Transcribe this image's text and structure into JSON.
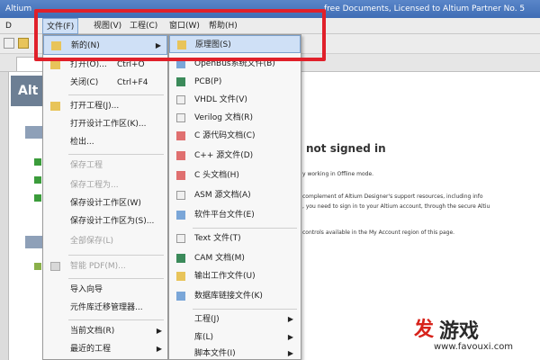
{
  "titlebar": {
    "left_text": "Altium",
    "right_text": "free Documents, Licensed to Altium Partner No. 5"
  },
  "menubar": {
    "items": [
      "文件(F)",
      "视图(V)",
      "工程(C)",
      "窗口(W)",
      "帮助(H)"
    ],
    "leading": "D"
  },
  "file_menu": {
    "items": [
      {
        "label": "新的(N)",
        "arrow": "▶"
      },
      {
        "label": "打开(O)...",
        "shortcut": "Ctrl+O"
      },
      {
        "label": "关闭(C)",
        "shortcut": "Ctrl+F4"
      },
      {
        "label": "打开工程(J)..."
      },
      {
        "label": "打开设计工作区(K)..."
      },
      {
        "label": "检出..."
      },
      {
        "label": "保存工程"
      },
      {
        "label": "保存工程为..."
      },
      {
        "label": "保存设计工作区(W)"
      },
      {
        "label": "保存设计工作区为(S)..."
      },
      {
        "label": "全部保存(L)"
      },
      {
        "label": "智能 PDF(M)..."
      },
      {
        "label": "导入向导"
      },
      {
        "label": "元件库迁移管理器..."
      },
      {
        "label": "当前文档(R)",
        "arrow": "▶"
      },
      {
        "label": "最近的工程",
        "arrow": "▶"
      },
      {
        "label": "最近的工作区",
        "arrow": "▶"
      }
    ]
  },
  "new_submenu": {
    "items": [
      {
        "label": "原理图(S)"
      },
      {
        "label": "OpenBus系统文件(B)"
      },
      {
        "label": "PCB(P)"
      },
      {
        "label": "VHDL 文件(V)"
      },
      {
        "label": "Verilog 文档(R)"
      },
      {
        "label": "C 源代码文档(C)"
      },
      {
        "label": "C++ 源文件(D)"
      },
      {
        "label": "C 头文档(H)"
      },
      {
        "label": "ASM 源文档(A)"
      },
      {
        "label": "软件平台文件(E)"
      },
      {
        "label": "Text 文件(T)"
      },
      {
        "label": "CAM 文档(M)"
      },
      {
        "label": "输出工作文件(U)"
      },
      {
        "label": "数据库链接文件(K)"
      },
      {
        "label": "工程(J)",
        "arrow": "▶"
      },
      {
        "label": "库(L)",
        "arrow": "▶"
      },
      {
        "label": "脚本文件(I)",
        "arrow": "▶"
      }
    ]
  },
  "workspace": {
    "banner": "Alt",
    "heading": "not signed in",
    "lines": [
      "y working in Offline mode.",
      "complement of Altium Designer's support resources, including info",
      ", you need to sign in to your Altium account, through the secure Altiu",
      "controls available in the My Account region of this page."
    ]
  },
  "watermark": {
    "logo": "发",
    "title": "游戏",
    "url": "www.favouxi.com"
  }
}
